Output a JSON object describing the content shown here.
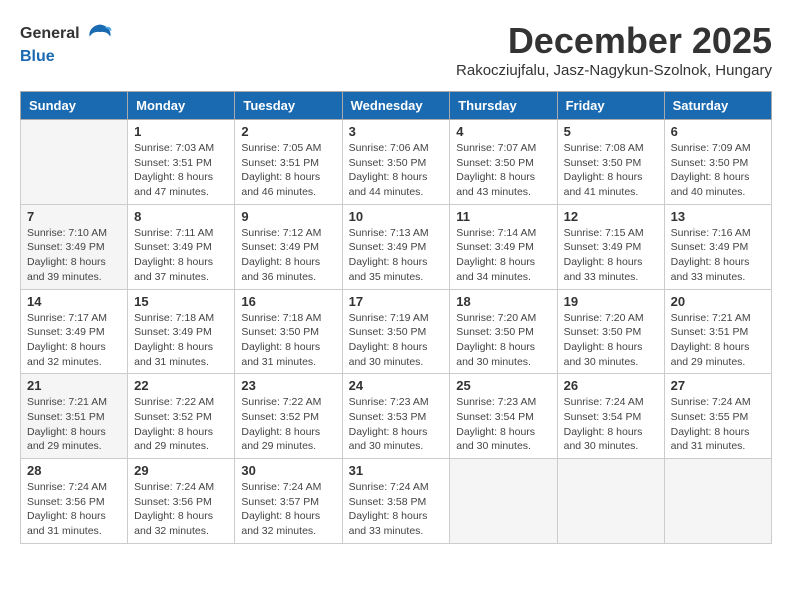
{
  "logo": {
    "general": "General",
    "blue": "Blue"
  },
  "title": "December 2025",
  "subtitle": "Rakocziujfalu, Jasz-Nagykun-Szolnok, Hungary",
  "headers": [
    "Sunday",
    "Monday",
    "Tuesday",
    "Wednesday",
    "Thursday",
    "Friday",
    "Saturday"
  ],
  "weeks": [
    [
      {
        "day": "",
        "info": ""
      },
      {
        "day": "1",
        "info": "Sunrise: 7:03 AM\nSunset: 3:51 PM\nDaylight: 8 hours\nand 47 minutes."
      },
      {
        "day": "2",
        "info": "Sunrise: 7:05 AM\nSunset: 3:51 PM\nDaylight: 8 hours\nand 46 minutes."
      },
      {
        "day": "3",
        "info": "Sunrise: 7:06 AM\nSunset: 3:50 PM\nDaylight: 8 hours\nand 44 minutes."
      },
      {
        "day": "4",
        "info": "Sunrise: 7:07 AM\nSunset: 3:50 PM\nDaylight: 8 hours\nand 43 minutes."
      },
      {
        "day": "5",
        "info": "Sunrise: 7:08 AM\nSunset: 3:50 PM\nDaylight: 8 hours\nand 41 minutes."
      },
      {
        "day": "6",
        "info": "Sunrise: 7:09 AM\nSunset: 3:50 PM\nDaylight: 8 hours\nand 40 minutes."
      }
    ],
    [
      {
        "day": "7",
        "info": "Sunrise: 7:10 AM\nSunset: 3:49 PM\nDaylight: 8 hours\nand 39 minutes."
      },
      {
        "day": "8",
        "info": "Sunrise: 7:11 AM\nSunset: 3:49 PM\nDaylight: 8 hours\nand 37 minutes."
      },
      {
        "day": "9",
        "info": "Sunrise: 7:12 AM\nSunset: 3:49 PM\nDaylight: 8 hours\nand 36 minutes."
      },
      {
        "day": "10",
        "info": "Sunrise: 7:13 AM\nSunset: 3:49 PM\nDaylight: 8 hours\nand 35 minutes."
      },
      {
        "day": "11",
        "info": "Sunrise: 7:14 AM\nSunset: 3:49 PM\nDaylight: 8 hours\nand 34 minutes."
      },
      {
        "day": "12",
        "info": "Sunrise: 7:15 AM\nSunset: 3:49 PM\nDaylight: 8 hours\nand 33 minutes."
      },
      {
        "day": "13",
        "info": "Sunrise: 7:16 AM\nSunset: 3:49 PM\nDaylight: 8 hours\nand 33 minutes."
      }
    ],
    [
      {
        "day": "14",
        "info": "Sunrise: 7:17 AM\nSunset: 3:49 PM\nDaylight: 8 hours\nand 32 minutes."
      },
      {
        "day": "15",
        "info": "Sunrise: 7:18 AM\nSunset: 3:49 PM\nDaylight: 8 hours\nand 31 minutes."
      },
      {
        "day": "16",
        "info": "Sunrise: 7:18 AM\nSunset: 3:50 PM\nDaylight: 8 hours\nand 31 minutes."
      },
      {
        "day": "17",
        "info": "Sunrise: 7:19 AM\nSunset: 3:50 PM\nDaylight: 8 hours\nand 30 minutes."
      },
      {
        "day": "18",
        "info": "Sunrise: 7:20 AM\nSunset: 3:50 PM\nDaylight: 8 hours\nand 30 minutes."
      },
      {
        "day": "19",
        "info": "Sunrise: 7:20 AM\nSunset: 3:50 PM\nDaylight: 8 hours\nand 30 minutes."
      },
      {
        "day": "20",
        "info": "Sunrise: 7:21 AM\nSunset: 3:51 PM\nDaylight: 8 hours\nand 29 minutes."
      }
    ],
    [
      {
        "day": "21",
        "info": "Sunrise: 7:21 AM\nSunset: 3:51 PM\nDaylight: 8 hours\nand 29 minutes."
      },
      {
        "day": "22",
        "info": "Sunrise: 7:22 AM\nSunset: 3:52 PM\nDaylight: 8 hours\nand 29 minutes."
      },
      {
        "day": "23",
        "info": "Sunrise: 7:22 AM\nSunset: 3:52 PM\nDaylight: 8 hours\nand 29 minutes."
      },
      {
        "day": "24",
        "info": "Sunrise: 7:23 AM\nSunset: 3:53 PM\nDaylight: 8 hours\nand 30 minutes."
      },
      {
        "day": "25",
        "info": "Sunrise: 7:23 AM\nSunset: 3:54 PM\nDaylight: 8 hours\nand 30 minutes."
      },
      {
        "day": "26",
        "info": "Sunrise: 7:24 AM\nSunset: 3:54 PM\nDaylight: 8 hours\nand 30 minutes."
      },
      {
        "day": "27",
        "info": "Sunrise: 7:24 AM\nSunset: 3:55 PM\nDaylight: 8 hours\nand 31 minutes."
      }
    ],
    [
      {
        "day": "28",
        "info": "Sunrise: 7:24 AM\nSunset: 3:56 PM\nDaylight: 8 hours\nand 31 minutes."
      },
      {
        "day": "29",
        "info": "Sunrise: 7:24 AM\nSunset: 3:56 PM\nDaylight: 8 hours\nand 32 minutes."
      },
      {
        "day": "30",
        "info": "Sunrise: 7:24 AM\nSunset: 3:57 PM\nDaylight: 8 hours\nand 32 minutes."
      },
      {
        "day": "31",
        "info": "Sunrise: 7:24 AM\nSunset: 3:58 PM\nDaylight: 8 hours\nand 33 minutes."
      },
      {
        "day": "",
        "info": ""
      },
      {
        "day": "",
        "info": ""
      },
      {
        "day": "",
        "info": ""
      }
    ]
  ]
}
